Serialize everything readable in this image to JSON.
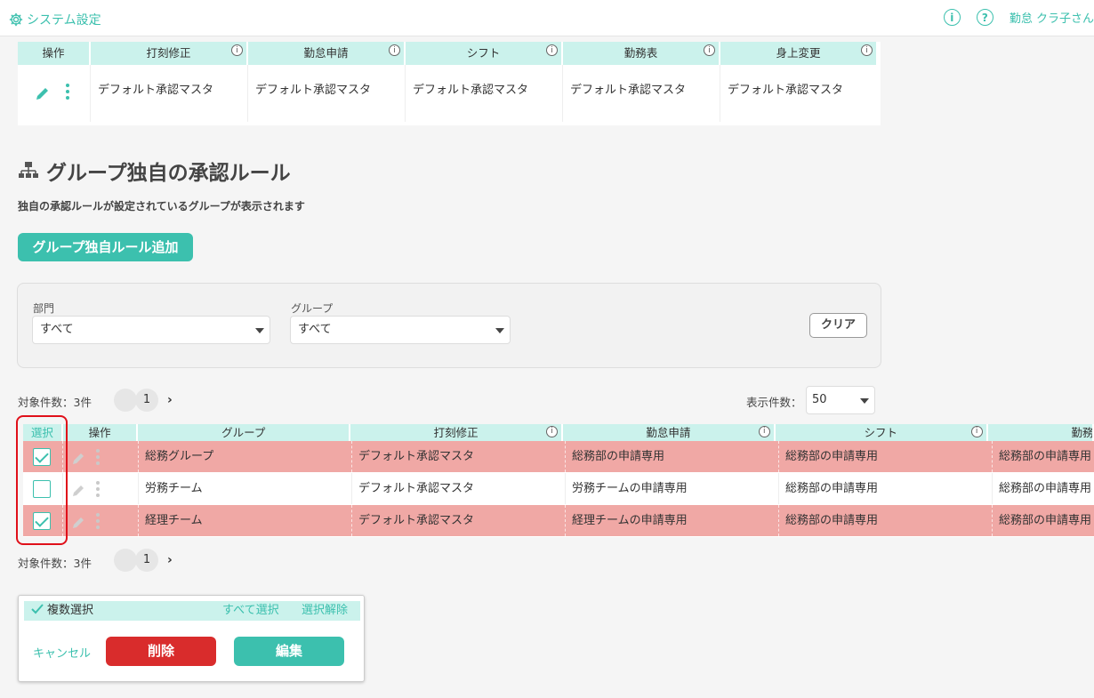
{
  "header": {
    "title": "システム設定",
    "user": "勤怠 クラ子さん"
  },
  "top_table": {
    "headers": [
      "操作",
      "打刻修正",
      "勤怠申請",
      "シフト",
      "勤務表",
      "身上変更"
    ],
    "row": [
      "デフォルト承認マスタ",
      "デフォルト承認マスタ",
      "デフォルト承認マスタ",
      "デフォルト承認マスタ",
      "デフォルト承認マスタ"
    ]
  },
  "section": {
    "title": "グループ独自の承認ルール",
    "subtitle": "独自の承認ルールが設定されているグループが表示されます",
    "add_button": "グループ独自ルール追加"
  },
  "filter": {
    "department_label": "部門",
    "department_value": "すべて",
    "group_label": "グループ",
    "group_value": "すべて",
    "clear_button": "クリア"
  },
  "pagination": {
    "count_text": "対象件数：3件",
    "current_page": "1",
    "next": "›",
    "per_page_label": "表示件数：",
    "per_page_value": "50"
  },
  "grid": {
    "headers": [
      "選択",
      "操作",
      "グループ",
      "打刻修正",
      "勤怠申請",
      "シフト",
      "勤務表"
    ],
    "rows": [
      {
        "selected": true,
        "cells": [
          "総務グループ",
          "デフォルト承認マスタ",
          "総務部の申請専用",
          "総務部の申請専用",
          "総務部の申請専用"
        ]
      },
      {
        "selected": false,
        "cells": [
          "労務チーム",
          "デフォルト承認マスタ",
          "労務チームの申請専用",
          "総務部の申請専用",
          "総務部の申請専用"
        ]
      },
      {
        "selected": true,
        "cells": [
          "経理チーム",
          "デフォルト承認マスタ",
          "経理チームの申請専用",
          "総務部の申請専用",
          "総務部の申請専用"
        ]
      }
    ]
  },
  "multi_select": {
    "label": "複数選択",
    "select_all": "すべて選択",
    "deselect": "選択解除",
    "cancel": "キャンセル",
    "delete": "削除",
    "edit": "編集"
  },
  "colors": {
    "accent": "#3cc0ae",
    "header_cell": "#cbf2ec",
    "selected_row": "#f0a8a5",
    "danger": "#d92c2c",
    "highlight": "#e0101a"
  }
}
